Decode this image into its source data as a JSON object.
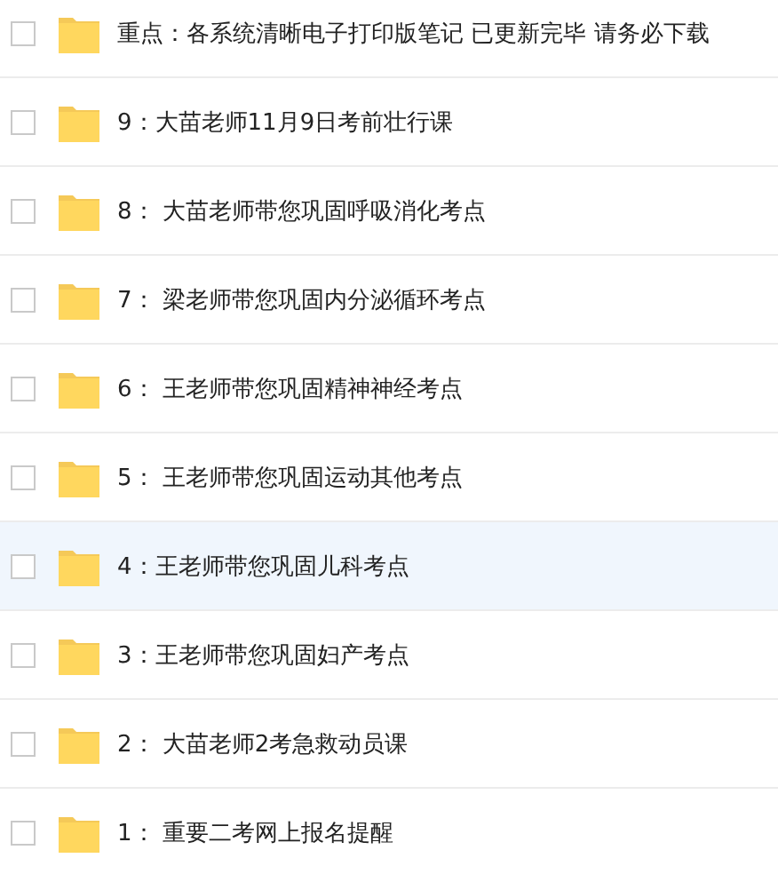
{
  "files": [
    {
      "name": "重点：各系统清晰电子打印版笔记 已更新完毕 请务必下载",
      "checked": false,
      "highlighted": false
    },
    {
      "name": "9：大苗老师11月9日考前壮行课",
      "checked": false,
      "highlighted": false
    },
    {
      "name": "8： 大苗老师带您巩固呼吸消化考点",
      "checked": false,
      "highlighted": false
    },
    {
      "name": "7： 梁老师带您巩固内分泌循环考点",
      "checked": false,
      "highlighted": false
    },
    {
      "name": "6： 王老师带您巩固精神神经考点",
      "checked": false,
      "highlighted": false
    },
    {
      "name": "5： 王老师带您巩固运动其他考点",
      "checked": false,
      "highlighted": false
    },
    {
      "name": "4：王老师带您巩固儿科考点",
      "checked": false,
      "highlighted": true
    },
    {
      "name": "3：王老师带您巩固妇产考点",
      "checked": false,
      "highlighted": false
    },
    {
      "name": "2： 大苗老师2考急救动员课",
      "checked": false,
      "highlighted": false
    },
    {
      "name": "1： 重要二考网上报名提醒",
      "checked": false,
      "highlighted": false
    }
  ]
}
